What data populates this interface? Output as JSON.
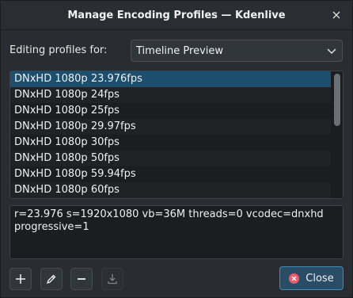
{
  "window": {
    "title": "Manage Encoding Profiles — Kdenlive"
  },
  "profiles_for": {
    "label": "Editing profiles for:",
    "selected": "Timeline Preview"
  },
  "profiles": {
    "items": [
      "DNxHD 1080p 23.976fps",
      "DNxHD 1080p 24fps",
      "DNxHD 1080p 25fps",
      "DNxHD 1080p 29.97fps",
      "DNxHD 1080p 30fps",
      "DNxHD 1080p 50fps",
      "DNxHD 1080p 59.94fps",
      "DNxHD 1080p 60fps"
    ],
    "selected_index": 0
  },
  "parameters": "r=23.976 s=1920x1080 vb=36M threads=0 vcodec=dnxhd progressive=1",
  "toolbar": {
    "add_icon": "plus-icon",
    "edit_icon": "pencil-icon",
    "remove_icon": "minus-icon",
    "download_icon": "download-icon"
  },
  "buttons": {
    "close_label": "Close"
  },
  "colors": {
    "accent": "#3d8dbf",
    "selection": "#1c4e6e",
    "close_icon": "#ed5a6a"
  }
}
